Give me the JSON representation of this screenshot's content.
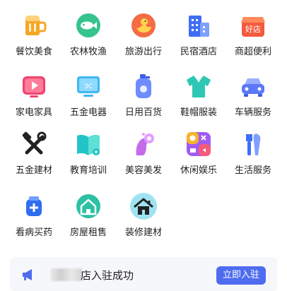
{
  "categories": [
    {
      "label": "餐饮美食",
      "icon": "beer-mug-icon"
    },
    {
      "label": "农林牧渔",
      "icon": "fish-icon"
    },
    {
      "label": "旅游出行",
      "icon": "duck-icon"
    },
    {
      "label": "民宿酒店",
      "icon": "building-icon"
    },
    {
      "label": "商超便利",
      "icon": "shop-icon",
      "badge": "好店"
    },
    {
      "label": "家电家具",
      "icon": "tv-icon"
    },
    {
      "label": "五金电器",
      "icon": "monitor-icon",
      "badge": "3C"
    },
    {
      "label": "日用百货",
      "icon": "detergent-bottle-icon"
    },
    {
      "label": "鞋帽服装",
      "icon": "shirt-icon"
    },
    {
      "label": "车辆服务",
      "icon": "car-icon"
    },
    {
      "label": "五金建材",
      "icon": "tools-icon"
    },
    {
      "label": "教育培训",
      "icon": "book-icon"
    },
    {
      "label": "美容美发",
      "icon": "beauty-head-icon"
    },
    {
      "label": "休闲娱乐",
      "icon": "leisure-icon"
    },
    {
      "label": "生活服务",
      "icon": "repair-tools-icon"
    },
    {
      "label": "看病买药",
      "icon": "medicine-icon"
    },
    {
      "label": "房屋租售",
      "icon": "house-icon"
    },
    {
      "label": "装修建材",
      "icon": "home-renovation-icon"
    }
  ],
  "banner": {
    "icon": "megaphone-icon",
    "message": "店入驻成功",
    "button_label": "立即入驻"
  }
}
